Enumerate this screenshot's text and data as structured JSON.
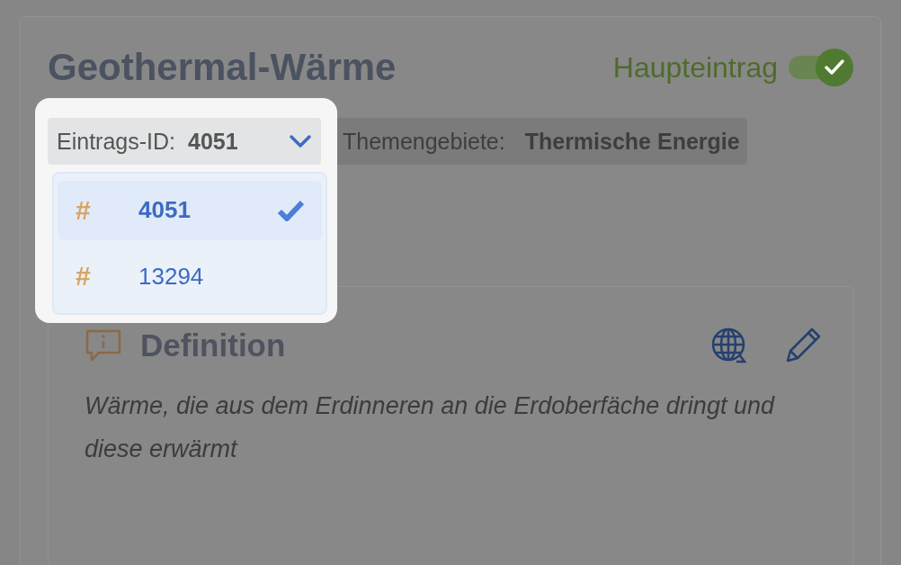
{
  "title": "Geothermal-Wärme",
  "main_entry": {
    "label": "Haupteintrag",
    "on": true
  },
  "entry_id": {
    "label": "Eintrags-ID:",
    "value": "4051",
    "expanded": true,
    "options": [
      {
        "prefix": "#",
        "label": "4051",
        "selected": true
      },
      {
        "prefix": "#",
        "label": "13294",
        "selected": false
      }
    ]
  },
  "topics": {
    "label": "Themengebiete:",
    "value": "Thermische Energie"
  },
  "definition": {
    "heading": "Definition",
    "text": "Wärme, die aus dem Erdinneren an die Erdoberfäche dringt und diese erwärmt"
  }
}
